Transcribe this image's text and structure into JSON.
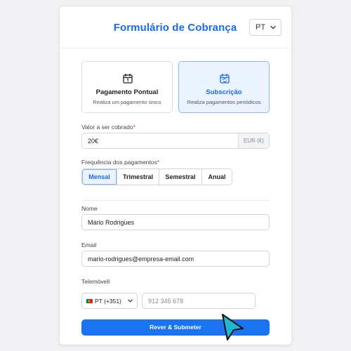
{
  "header": {
    "title": "Formulário de Cobrança",
    "language": "PT"
  },
  "payment_types": [
    {
      "title": "Pagamento Pontual",
      "subtitle": "Realiza um pagamento único",
      "icon": "calendar-icon",
      "selected": false
    },
    {
      "title": "Subscrição",
      "subtitle": "Realiza pagamentos periódicos",
      "icon": "calendar-repeat-icon",
      "selected": true
    }
  ],
  "amount": {
    "label": "Valor a ser cobrado",
    "required_mark": "*",
    "value": "20€",
    "unit": "EUR (€)"
  },
  "frequency": {
    "label": "Frequência dos pagamentos",
    "required_mark": "*",
    "options": [
      "Mensal",
      "Trimestral",
      "Semestral",
      "Anual"
    ],
    "selected": "Mensal"
  },
  "name": {
    "label": "Nome",
    "value": "Mário Rodrigues"
  },
  "email": {
    "label": "Email",
    "value": "mario-rodrigues@empresa-email.com"
  },
  "phone": {
    "label": "Telemóvell",
    "country_code": "PT (+351)",
    "placeholder": "912 345 678"
  },
  "submit": {
    "label": "Rever & Submeter"
  },
  "colors": {
    "accent": "#1a73f0",
    "title": "#1a6be8",
    "selected_bg": "#eaf3fe",
    "required": "#e03535"
  }
}
